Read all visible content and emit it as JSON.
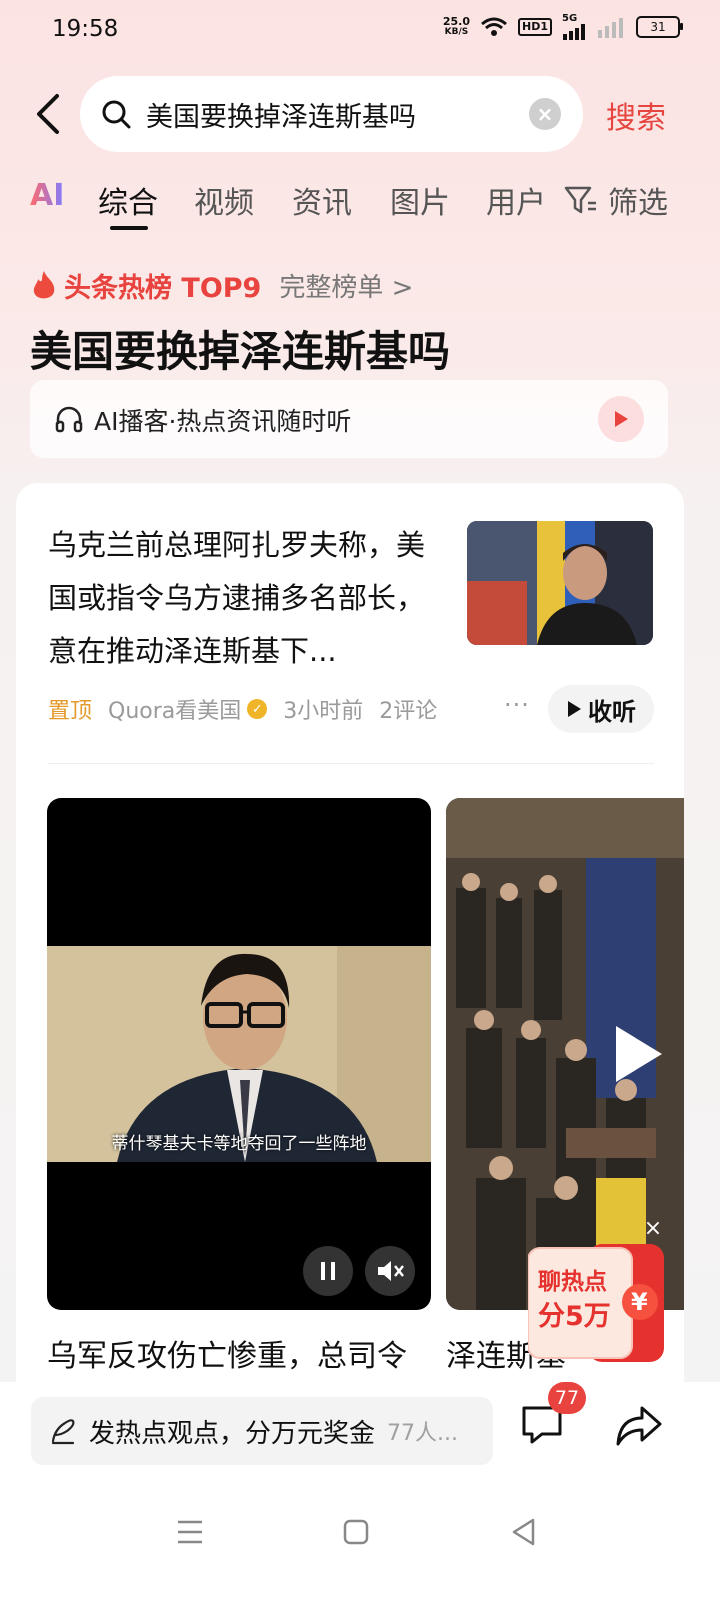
{
  "status_bar": {
    "time": "19:58",
    "net_speed_value": "25.0",
    "net_speed_unit": "KB/S",
    "hd_label": "HD1",
    "signal_label": "5G",
    "battery": "31"
  },
  "search": {
    "query": "美国要换掉泽连斯基吗",
    "search_button": "搜索"
  },
  "tabs": [
    {
      "label": "AI"
    },
    {
      "label": "综合"
    },
    {
      "label": "视频"
    },
    {
      "label": "资讯"
    },
    {
      "label": "图片"
    },
    {
      "label": "用户"
    },
    {
      "label": "筛选"
    }
  ],
  "hot": {
    "title": "头条热榜 TOP9",
    "link": "完整榜单 >",
    "headline": "美国要换掉泽连斯基吗",
    "podcast": "AI播客·热点资讯随时听"
  },
  "article": {
    "title": "乌克兰前总理阿扎罗夫称，美国或指令乌方逮捕多名部长，意在推动泽连斯基下...",
    "pin": "置顶",
    "source": "Quora看美国",
    "time": "3小时前",
    "comments": "2评论",
    "listen": "收听"
  },
  "videos": [
    {
      "subtitle": "蒂什琴基夫卡等地夺回了一些阵地",
      "caption": "乌军反攻伤亡惨重，总司令"
    },
    {
      "caption": "泽连斯基"
    }
  ],
  "promo": {
    "line1": "聊热点",
    "line2": "分5万",
    "symbol": "¥"
  },
  "bottom": {
    "comment_prompt": "发热点观点，分万元奖金",
    "comment_count": "77人...",
    "badge": "77"
  },
  "colors": {
    "accent": "#e6463f",
    "pin": "#e39a2a"
  }
}
